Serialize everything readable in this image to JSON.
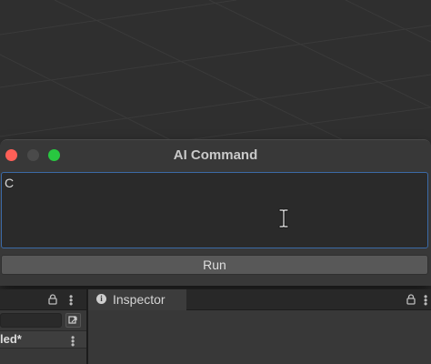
{
  "window": {
    "title": "AI Command",
    "input_value": "C",
    "run_label": "Run"
  },
  "left_panel": {
    "row_label": "led*"
  },
  "right_panel": {
    "tab_label": "Inspector"
  },
  "colors": {
    "close": "#ff5f57",
    "minimize": "#4a4a4a",
    "maximize": "#28c840",
    "input_border": "#3b6aa6"
  },
  "icons": [
    "lock-icon",
    "more-vert-icon",
    "info-icon",
    "search-icon",
    "text-cursor-icon"
  ]
}
